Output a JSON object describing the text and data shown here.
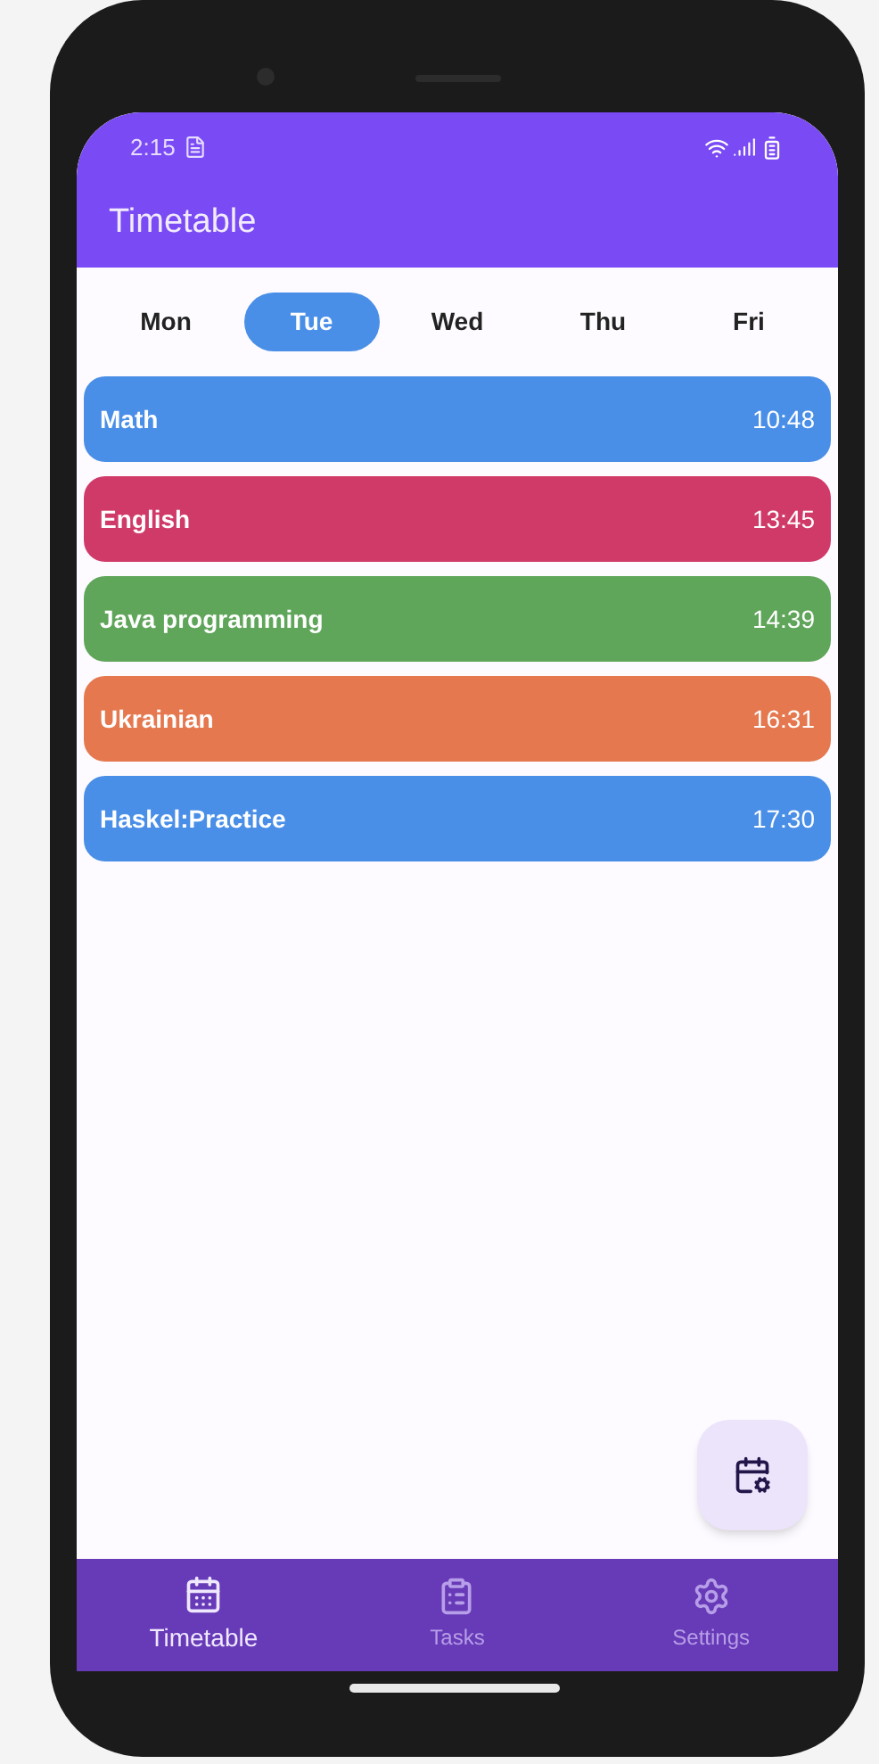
{
  "status_bar": {
    "time": "2:15"
  },
  "app_bar": {
    "title": "Timetable"
  },
  "days": [
    {
      "label": "Mon",
      "selected": false
    },
    {
      "label": "Tue",
      "selected": true
    },
    {
      "label": "Wed",
      "selected": false
    },
    {
      "label": "Thu",
      "selected": false
    },
    {
      "label": "Fri",
      "selected": false
    }
  ],
  "lessons": [
    {
      "name": "Math",
      "time": "10:48",
      "color": "#4a8fe7"
    },
    {
      "name": "English",
      "time": "13:45",
      "color": "#d03a68"
    },
    {
      "name": "Java programming",
      "time": "14:39",
      "color": "#5fa55a"
    },
    {
      "name": "Ukrainian",
      "time": "16:31",
      "color": "#e5784f"
    },
    {
      "name": "Haskel:Practice",
      "time": "17:30",
      "color": "#4a8fe7"
    }
  ],
  "bottom_nav": [
    {
      "label": "Timetable",
      "kind": "calendar",
      "selected": true
    },
    {
      "label": "Tasks",
      "kind": "clipboard",
      "selected": false
    },
    {
      "label": "Settings",
      "kind": "gear",
      "selected": false
    }
  ]
}
